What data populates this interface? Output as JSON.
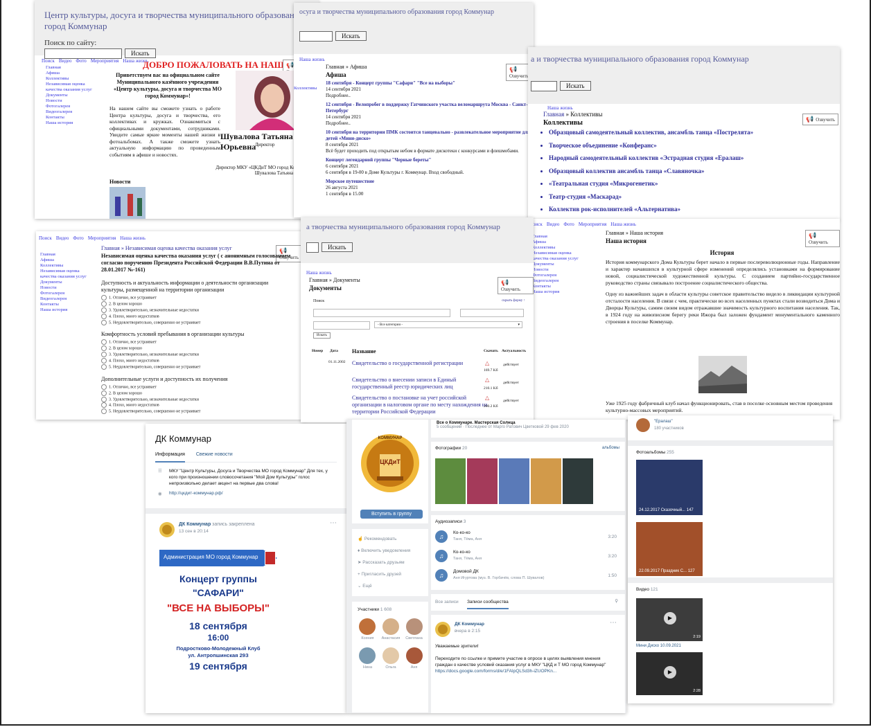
{
  "site": {
    "title": "Центр культуры, досуга и творчества муниципального образования город Коммунар",
    "title_partial_1": "осуга и творчества муниципального образования город Коммунар",
    "title_partial_2": "а и творчества муниципального образования город Коммунар",
    "title_partial_3": "а творчества муниципального образования город Коммунар",
    "search_label": "Поиск по сайту:",
    "search_button": "Искать",
    "listen_label": "Озвучить",
    "menu": [
      "Поиск",
      "Видео",
      "Фото",
      "Мероприятия",
      "Наша жизнь"
    ],
    "menu_short": [
      "Наша жизнь"
    ],
    "sidebar": [
      "Главная",
      "Афиша",
      "Коллективы",
      "Независимая оценка качества оказания услуг",
      "Документы",
      "Новости",
      "Фотогалерея",
      "Видеогалерея",
      "Контакты",
      "Наша история"
    ]
  },
  "home": {
    "welcome": "ДОБРО ПОЖАЛОВАТЬ НА НАШ САЙТ!",
    "greeting": "Приветствуем вас на официальном сайте Муниципального казённого учреждения «Центр культуры, досуга и творчества МО город Коммунар»!",
    "body": "На нашем сайте вы сможете узнать о работе Центра культуры, досуга и творчества, его коллективах и кружках. Ознакомиться с официальными документами, сотрудниками. Увидите самые яркие моменты нашей жизни в фотоальбомах. А также сможете узнать актуальную информацию по проведенным событиям в афише и новостях.",
    "director_name": "Шувалова Татьяна Юрьевна",
    "director_role": "Директор",
    "signature_1": "Директор МКУ «ЦКДиТ МО город Коммунар»",
    "signature_2": "Шувалова Татьяна Юрьевна",
    "news_heading": "Новости"
  },
  "afisha": {
    "breadcrumb": "Главная » Афиша",
    "heading": "Афиша",
    "events": [
      {
        "title": "18 сентября - Концерт группы \"Сафари\" \"Все на выборы\"",
        "date": "14 сентября 2021",
        "text": "Подробнее.."
      },
      {
        "title": "12 сентября - Велопробег в поддержку Гатчинского участка веломаршрута Москва - Санкт-Петербург",
        "date": "14 сентября 2021",
        "text": "Подробнее.."
      },
      {
        "title": "10 сентября на территории ПМК состоится танцевально - развлекательное мероприятие для детей «Мини-диско»",
        "date": "8 сентября 2021",
        "text": "Всё будет проходить под открытым небом в формате дискотеки с конкурсами и флешмобами."
      },
      {
        "title": "Концерт легендарной группы \"Черные береты\"",
        "date": "6 сентября 2021",
        "text": "6 сентября в 19-00 в Доме Культуры г. Коммунар. Вход свободный."
      },
      {
        "title": "Морское путешествие",
        "date": "26 августа 2021",
        "text": "1 сентября в 15.00"
      }
    ]
  },
  "collectives": {
    "breadcrumb_home": "Главная",
    "breadcrumb_current": "» Коллективы",
    "heading": "Коллективы",
    "items": [
      "Образцовый самодеятельный коллектив, ансамбль танца «Пострелята»",
      "Творческое объединение «Конферанс»",
      "Народный самодеятельный коллектив «Эстрадная студия «Ералаш»",
      "Образцовый коллектив ансамбль танца «Славяночка»",
      "«Театральная студия «Микрогенетик»",
      "Театр-студия «Маскарад»",
      "Коллектив рок-исполнителей «Альтернатива»"
    ]
  },
  "survey": {
    "breadcrumb": "Главная » Независимая оценка качества оказания услуг",
    "heading": "Независимая оценка качества оказания услуг ( с анонимным голосованием согласно поручению Президента Российской Федерации В.В.Путина от 28.01.2017 №-161)",
    "sections": [
      {
        "title": "Доступность и актуальность информации о деятельности организации культуры, размещенной на территории организации",
        "options": [
          "1. Отлично, все устраивает",
          "2. В целом хорошо",
          "3. Удовлетворительно, незначительные недостатки",
          "4. Плохо, много недостатков",
          "5. Неудовлетворительно, совершенно не устраивает"
        ]
      },
      {
        "title": "Комфортность условий пребывания в организации культуры",
        "options": [
          "1. Отлично, все устраивает",
          "2. В целом хорошо",
          "3. Удовлетворительно, незначительные недостатки",
          "4. Плохо, много недостатков",
          "5. Неудовлетворительно, совершенно не устраивает"
        ]
      },
      {
        "title": "Дополнительные услуги и доступность их получения",
        "options": [
          "1. Отлично, все устраивает",
          "2. В целом хорошо",
          "3. Удовлетворительно, незначительные недостатки",
          "4. Плохо, много недостатков",
          "5. Неудовлетворительно, совершенно не устраивает"
        ]
      }
    ]
  },
  "documents": {
    "breadcrumb": "Главная » Документы",
    "heading": "Документы",
    "search_label": "Поиск",
    "hide_form": "скрыть форму ↑",
    "category_placeholder": "- Все категории -",
    "find_button": "Искать",
    "columns": {
      "number": "Номер",
      "date": "Дата",
      "name": "Название",
      "download": "Скачать",
      "status": "Актуальность"
    },
    "rows": [
      {
        "date": "01.11.2002",
        "name": "Свидетельство о государственной регистрации",
        "size": "169.7 Kб",
        "status": "действует"
      },
      {
        "date": "",
        "name": "Свидетельство о внесении записи в Единый государственный реестр юридических лиц",
        "size": "210.1 Kб",
        "status": "действует"
      },
      {
        "date": "",
        "name": "Свидетельство о постановке на учет российской организации в налоговом органе по месту нахождения на территории Российской Федерации",
        "size": "200.2 Kб",
        "status": "действует"
      }
    ]
  },
  "history": {
    "breadcrumb": "Главная » Наша история",
    "heading": "Наша история",
    "subheading": "История",
    "p1": "История коммунарского Дома Культуры берет начало в первые послереволюционные годы. Направление и характер начавшихся в культурной сфере изменений определялись установками на формирование новой, социалистической художественной культуры. С созданием партийно-государственное руководство страны связывало построение социалистического общества.",
    "p2": "Одну из важнейших задач в области культуры советское правительство видело в ликвидации культурной отсталости населения. В связи с чем, практически во всех населенных пунктах стали возводиться Дома и Дворцы Культуры, самим своим видом отражавшие значимость культурного воспитания населения. Так, в 1924 году на живописном берегу реки Ижора был заложен фундамент монументального каменного строения в поселке Коммунар.",
    "p3": "Уже 1925 году фабричный клуб начал функционировать, став в поселке основным местом проведения культурно-массовых мероприятий."
  },
  "vk": {
    "group_name": "ДК Коммунар",
    "tabs": [
      "Информация",
      "Свежие новости"
    ],
    "description": "МКУ \"Центр Культуры, Досуга и Творчества МО город Коммунар\" Для тех, у кого при произношении словосочетания \"Мой Дом Культуры\" голос непроизвольно делает акцент на первые два слова!",
    "link": "http://цкдит-коммунар.рф/",
    "post_author": "ДК Коммунар",
    "post_pinned": "запись закреплена",
    "post_date": "13 сен в 20:14",
    "poster_admin": "Администрация МО город Коммунар",
    "poster_title_1": "Концерт группы",
    "poster_title_2": "\"САФАРИ\"",
    "poster_title_3": "\"ВСЕ НА ВЫБОРЫ\"",
    "poster_date": "18 сентября",
    "poster_time": "16:00",
    "poster_place_1": "Подростково-Молодежный Клуб",
    "poster_place_2": "ул. Антропшинская 29З",
    "poster_next": "19 сентября",
    "discussion_title": "Все о Коммунаре. Мастерская Солнца",
    "discussion_meta": "5 сообщений · Последнее от Марго Ратович Цветковой 29 фев 2020",
    "logo_word_1": "КОММУНАР",
    "logo_word_2": "ЦКДиТ",
    "join_button": "Вступить в группу",
    "actions": [
      "Рекомендовать",
      "Включить уведомления",
      "Рассказать друзьям",
      "Пригласить друзей",
      "Ещё"
    ],
    "members_label": "Участники",
    "members_count": "1 608",
    "members": [
      "Ксения",
      "Анастасия",
      "Светлана",
      "Нина",
      "Ольга",
      "Аня"
    ],
    "photos_label": "Фотографии",
    "photos_count": "20",
    "photos_all": "альбомы",
    "audio_label": "Аудиозаписи",
    "audio_count": "3",
    "audio": [
      {
        "title": "Ко-ко-ко",
        "artist": "Таня, Тёма, Аня",
        "duration": "3:20"
      },
      {
        "title": "Ко-ко-ко",
        "artist": "Таня, Тёма, Аня",
        "duration": "3:20"
      },
      {
        "title": "Домовой ДК",
        "artist": "Аня Игуртова (муз. В. Горбачёв, слова П. Шувалов)",
        "duration": "1:50"
      }
    ],
    "wall_tabs": [
      "Все записи",
      "Записи сообщества"
    ],
    "wall_post_author": "ДК Коммунар",
    "wall_post_date": "вчера в 2:15",
    "wall_post_greeting": "Уважаемые зрители!",
    "wall_post_text": "Переходите по ссылке и примите участие в опросе в целях выявления мнения граждан о качестве условий оказания услуг в МКУ \"ЦКД и Т МО город Коммунар\"",
    "wall_post_link": "https://docs.google.com/forms/d/e/1FAIpQLSd3h-iZUOPKn...",
    "right_group": "\"Ералаш\"",
    "right_group_members": "180 участников",
    "albums_label": "Фотоальбомы",
    "albums_count": "255",
    "albums": [
      {
        "date": "24.12.2017",
        "title": "Сказочный...",
        "count": "147"
      },
      {
        "date": "22.09.2017",
        "title": "Праздник С...",
        "count": "127"
      }
    ],
    "video_label": "Видео",
    "video_count": "121",
    "videos": [
      {
        "duration": "2:19",
        "title": "Мини Диско 10.09.2021"
      },
      {
        "duration": "2:28",
        "title": ""
      }
    ]
  }
}
